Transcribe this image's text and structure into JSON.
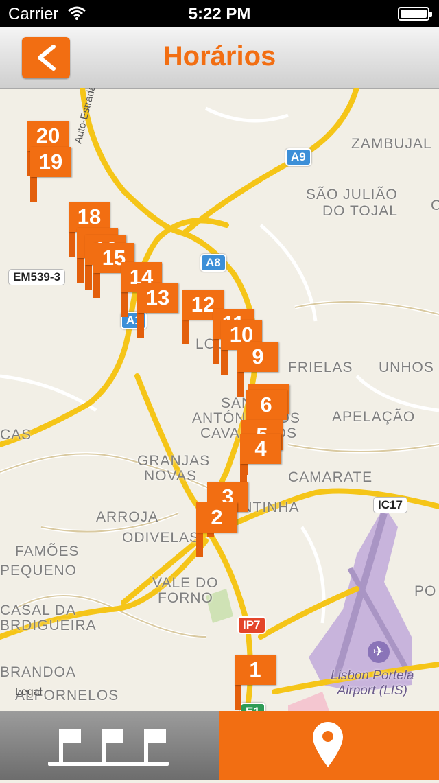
{
  "status_bar": {
    "carrier": "Carrier",
    "time": "5:22 PM"
  },
  "nav": {
    "title": "Horários",
    "back_icon": "chevron-left-icon"
  },
  "map": {
    "places": [
      "ZAMBUJAL",
      "SÃO JULIÃO",
      "DO TOJAL",
      "FRIELAS",
      "UNHOS",
      "APELAÇÃO",
      "CAMARATE",
      "SANTO",
      "ANTÓNIO DOS",
      "CAVALEIROS",
      "GRANJAS",
      "NOVAS",
      "ARROJA",
      "ODIVELAS",
      "FAMÕES",
      "PEQUENO",
      "VALE DO",
      "FORNO",
      "CASAL DA",
      "BRDIGUEIRA",
      "BRANDOA",
      "ALFORNELOS",
      "PONTINHA",
      "LOURES",
      "C",
      "PO",
      "CAS"
    ],
    "road_labels": [
      "Auto-Estrada",
      "EM539-3",
      "IC17",
      "A9",
      "A8",
      "A1",
      "IP7",
      "E1"
    ],
    "airport": {
      "line1": "Lisbon Portela",
      "line2": "Airport (LIS)"
    },
    "legal": "Legal",
    "stops": [
      "1",
      "2",
      "3",
      "4",
      "5",
      "6",
      "8",
      "9",
      "10",
      "11",
      "12",
      "13",
      "14",
      "15",
      "16",
      "17",
      "18",
      "19",
      "20"
    ]
  },
  "tabs": {
    "schedule_icon": "bus-stops-icon",
    "map_icon": "map-pin-icon",
    "active": "map"
  },
  "colors": {
    "accent": "#f26e12",
    "road": "#f5c518",
    "map_bg": "#f2efe6",
    "airport": "#c8b4dc"
  }
}
